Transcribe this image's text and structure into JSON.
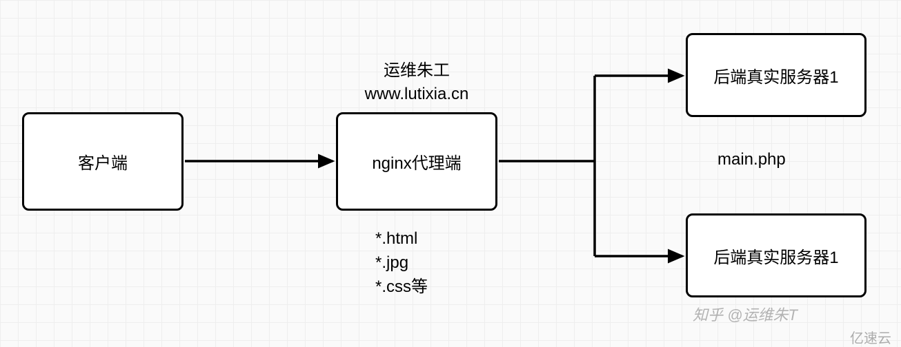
{
  "boxes": {
    "client": "客户端",
    "proxy": "nginx代理端",
    "server1": "后端真实服务器1",
    "server2": "后端真实服务器1"
  },
  "labels": {
    "proxy_top": "运维朱工\nwww.lutixia.cn",
    "proxy_bottom": "*.html\n*.jpg\n*.css等",
    "between_servers": "main.php"
  },
  "watermarks": {
    "zhihu": "知乎 @运维朱T",
    "yisu": "亿速云"
  }
}
